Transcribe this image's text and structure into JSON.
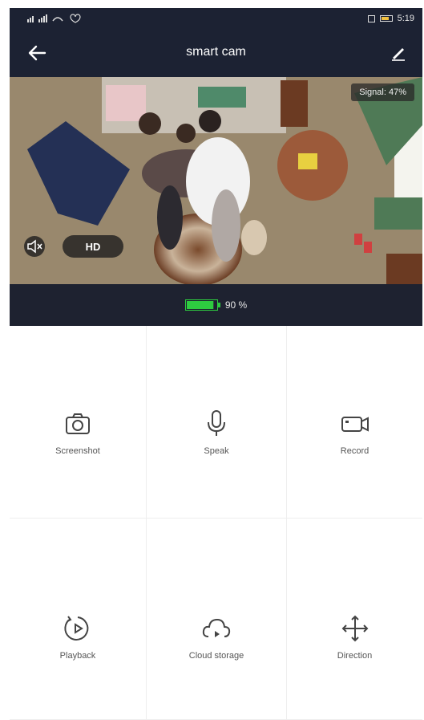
{
  "status_bar": {
    "left": "°•é °•é ≈ ♡",
    "time": "5:19"
  },
  "nav": {
    "title": "smart cam"
  },
  "video": {
    "signal_label": "Signal: 47%",
    "hd_label": "HD"
  },
  "battery": {
    "percent_label": "90 %",
    "level": 0.9
  },
  "actions": [
    {
      "label": "Screenshot",
      "icon": "camera-icon"
    },
    {
      "label": "Speak",
      "icon": "microphone-icon"
    },
    {
      "label": "Record",
      "icon": "video-camera-icon"
    },
    {
      "label": "Playback",
      "icon": "playback-icon"
    },
    {
      "label": "Cloud storage",
      "icon": "cloud-storage-icon"
    },
    {
      "label": "Direction",
      "icon": "direction-icon"
    }
  ],
  "colors": {
    "header_bg": "#1c2233",
    "battery_green": "#2ecc40"
  }
}
